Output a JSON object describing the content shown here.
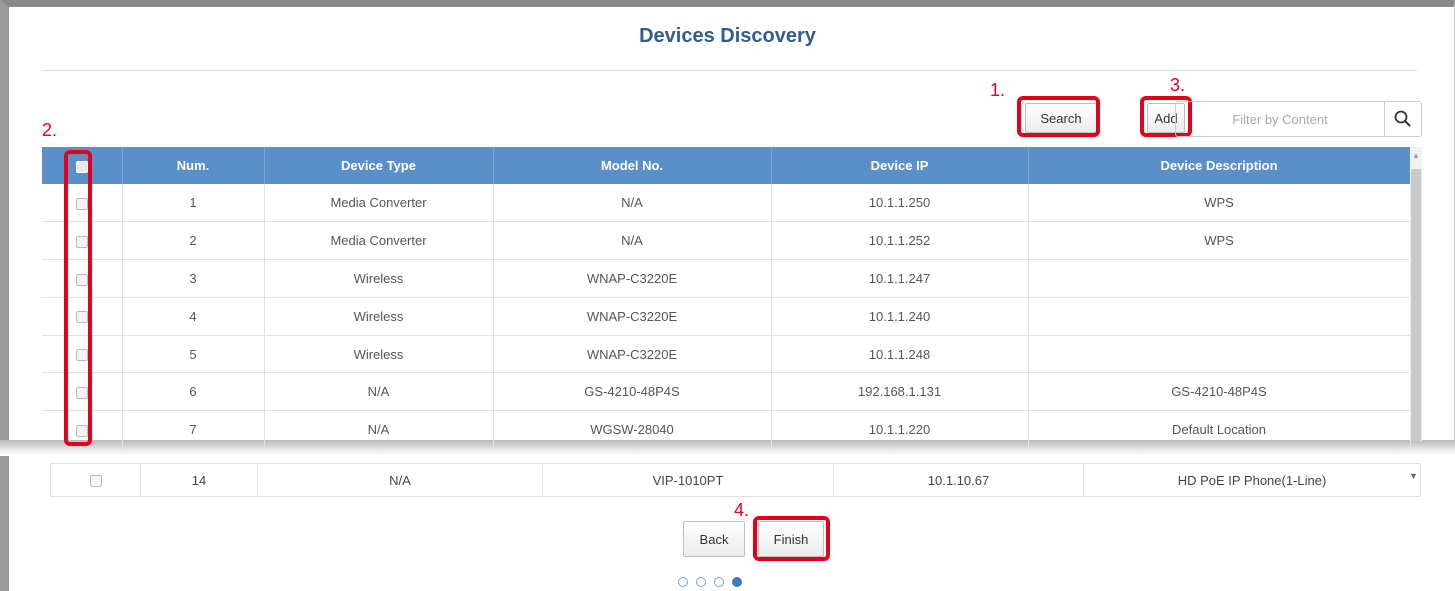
{
  "page": {
    "title": "Devices Discovery"
  },
  "toolbar": {
    "search_label": "Search",
    "add_label": "Add",
    "filter_placeholder": "Filter by Content",
    "filter_icon": "magnifier-icon"
  },
  "annotations": {
    "step1": "1.",
    "step2": "2.",
    "step3": "3.",
    "step4": "4.",
    "highlight_color": "#e3001b"
  },
  "table": {
    "columns": [
      "",
      "Num.",
      "Device Type",
      "Model No.",
      "Device IP",
      "Device Description"
    ],
    "rows": [
      {
        "num": "1",
        "type": "Media Converter",
        "model": "N/A",
        "ip": "10.1.1.250",
        "desc": "WPS"
      },
      {
        "num": "2",
        "type": "Media Converter",
        "model": "N/A",
        "ip": "10.1.1.252",
        "desc": "WPS"
      },
      {
        "num": "3",
        "type": "Wireless",
        "model": "WNAP-C3220E",
        "ip": "10.1.1.247",
        "desc": ""
      },
      {
        "num": "4",
        "type": "Wireless",
        "model": "WNAP-C3220E",
        "ip": "10.1.1.240",
        "desc": ""
      },
      {
        "num": "5",
        "type": "Wireless",
        "model": "WNAP-C3220E",
        "ip": "10.1.1.248",
        "desc": ""
      },
      {
        "num": "6",
        "type": "N/A",
        "model": "GS-4210-48P4S",
        "ip": "192.168.1.131",
        "desc": "GS-4210-48P4S"
      },
      {
        "num": "7",
        "type": "N/A",
        "model": "WGSW-28040",
        "ip": "10.1.1.220",
        "desc": "Default Location"
      }
    ],
    "last_row": {
      "num": "14",
      "type": "N/A",
      "model": "VIP-1010PT",
      "ip": "10.1.10.67",
      "desc": "HD PoE IP Phone(1-Line)"
    }
  },
  "footer": {
    "back_label": "Back",
    "finish_label": "Finish",
    "steps_total": 4,
    "steps_active": 4
  },
  "colors": {
    "header_bg": "#5b8fc7",
    "title": "#2f5d8f"
  }
}
